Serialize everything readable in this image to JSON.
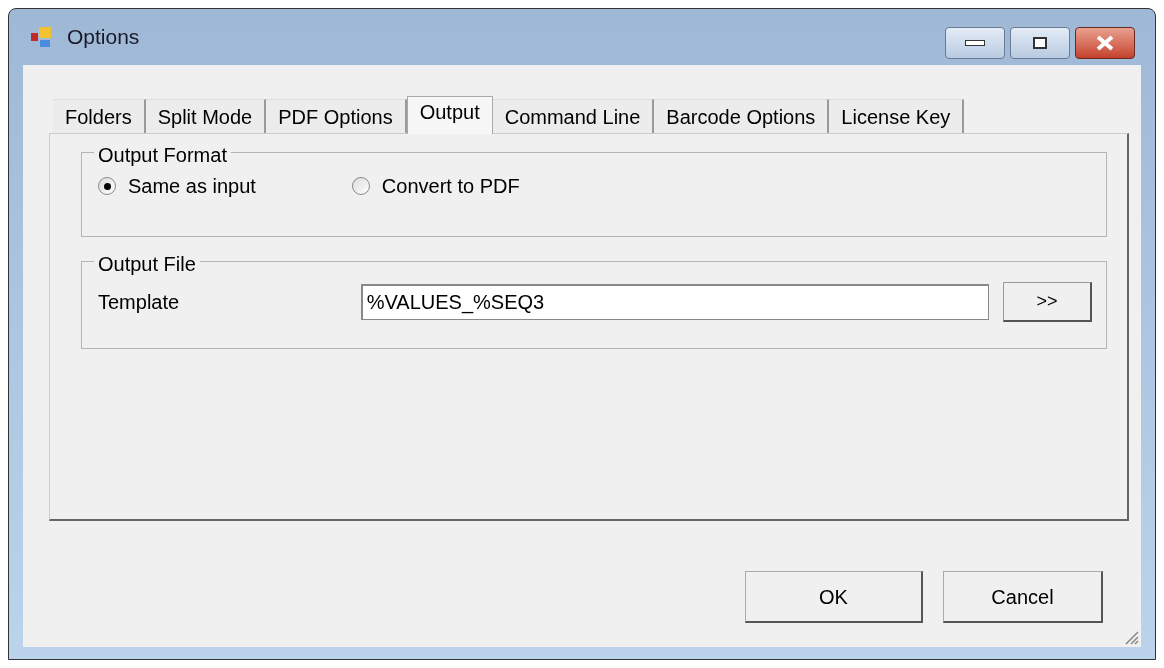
{
  "window": {
    "title": "Options"
  },
  "tabs": [
    {
      "label": "Folders",
      "selected": false
    },
    {
      "label": "Split Mode",
      "selected": false
    },
    {
      "label": "PDF Options",
      "selected": false
    },
    {
      "label": "Output",
      "selected": true
    },
    {
      "label": "Command Line",
      "selected": false
    },
    {
      "label": "Barcode Options",
      "selected": false
    },
    {
      "label": "License Key",
      "selected": false
    }
  ],
  "output_format": {
    "title": "Output Format",
    "options": [
      {
        "label": "Same as input",
        "selected": true
      },
      {
        "label": "Convert to PDF",
        "selected": false
      }
    ]
  },
  "output_file": {
    "title": "Output File",
    "label": "Template",
    "value": "%VALUES_%SEQ3",
    "browse_button": ">>"
  },
  "buttons": [
    "OK",
    "Cancel"
  ]
}
